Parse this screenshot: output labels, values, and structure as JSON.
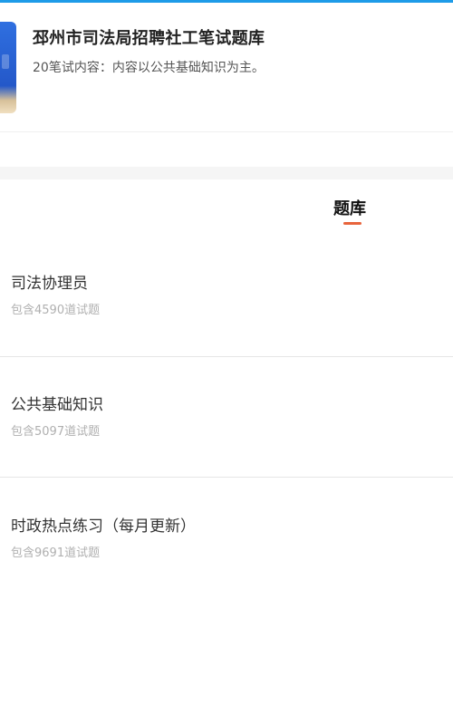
{
  "header": {
    "title": "邳州市司法局招聘社工笔试题库",
    "description": "20笔试内容：内容以公共基础知识为主。",
    "cover_colors": {
      "primary": "#2f6fe0",
      "accent": "#f0dfc0"
    }
  },
  "tabs": {
    "active_label": "题库",
    "accent_color": "#e8643c"
  },
  "items": [
    {
      "title": "司法协理员",
      "count": "包含4590道试题"
    },
    {
      "title": "公共基础知识",
      "count": "包含5097道试题"
    },
    {
      "title": "时政热点练习（每月更新）",
      "count": "包含9691道试题"
    }
  ],
  "theme": {
    "top_bar": "#1e9be8",
    "divider": "#e6e6e6"
  }
}
